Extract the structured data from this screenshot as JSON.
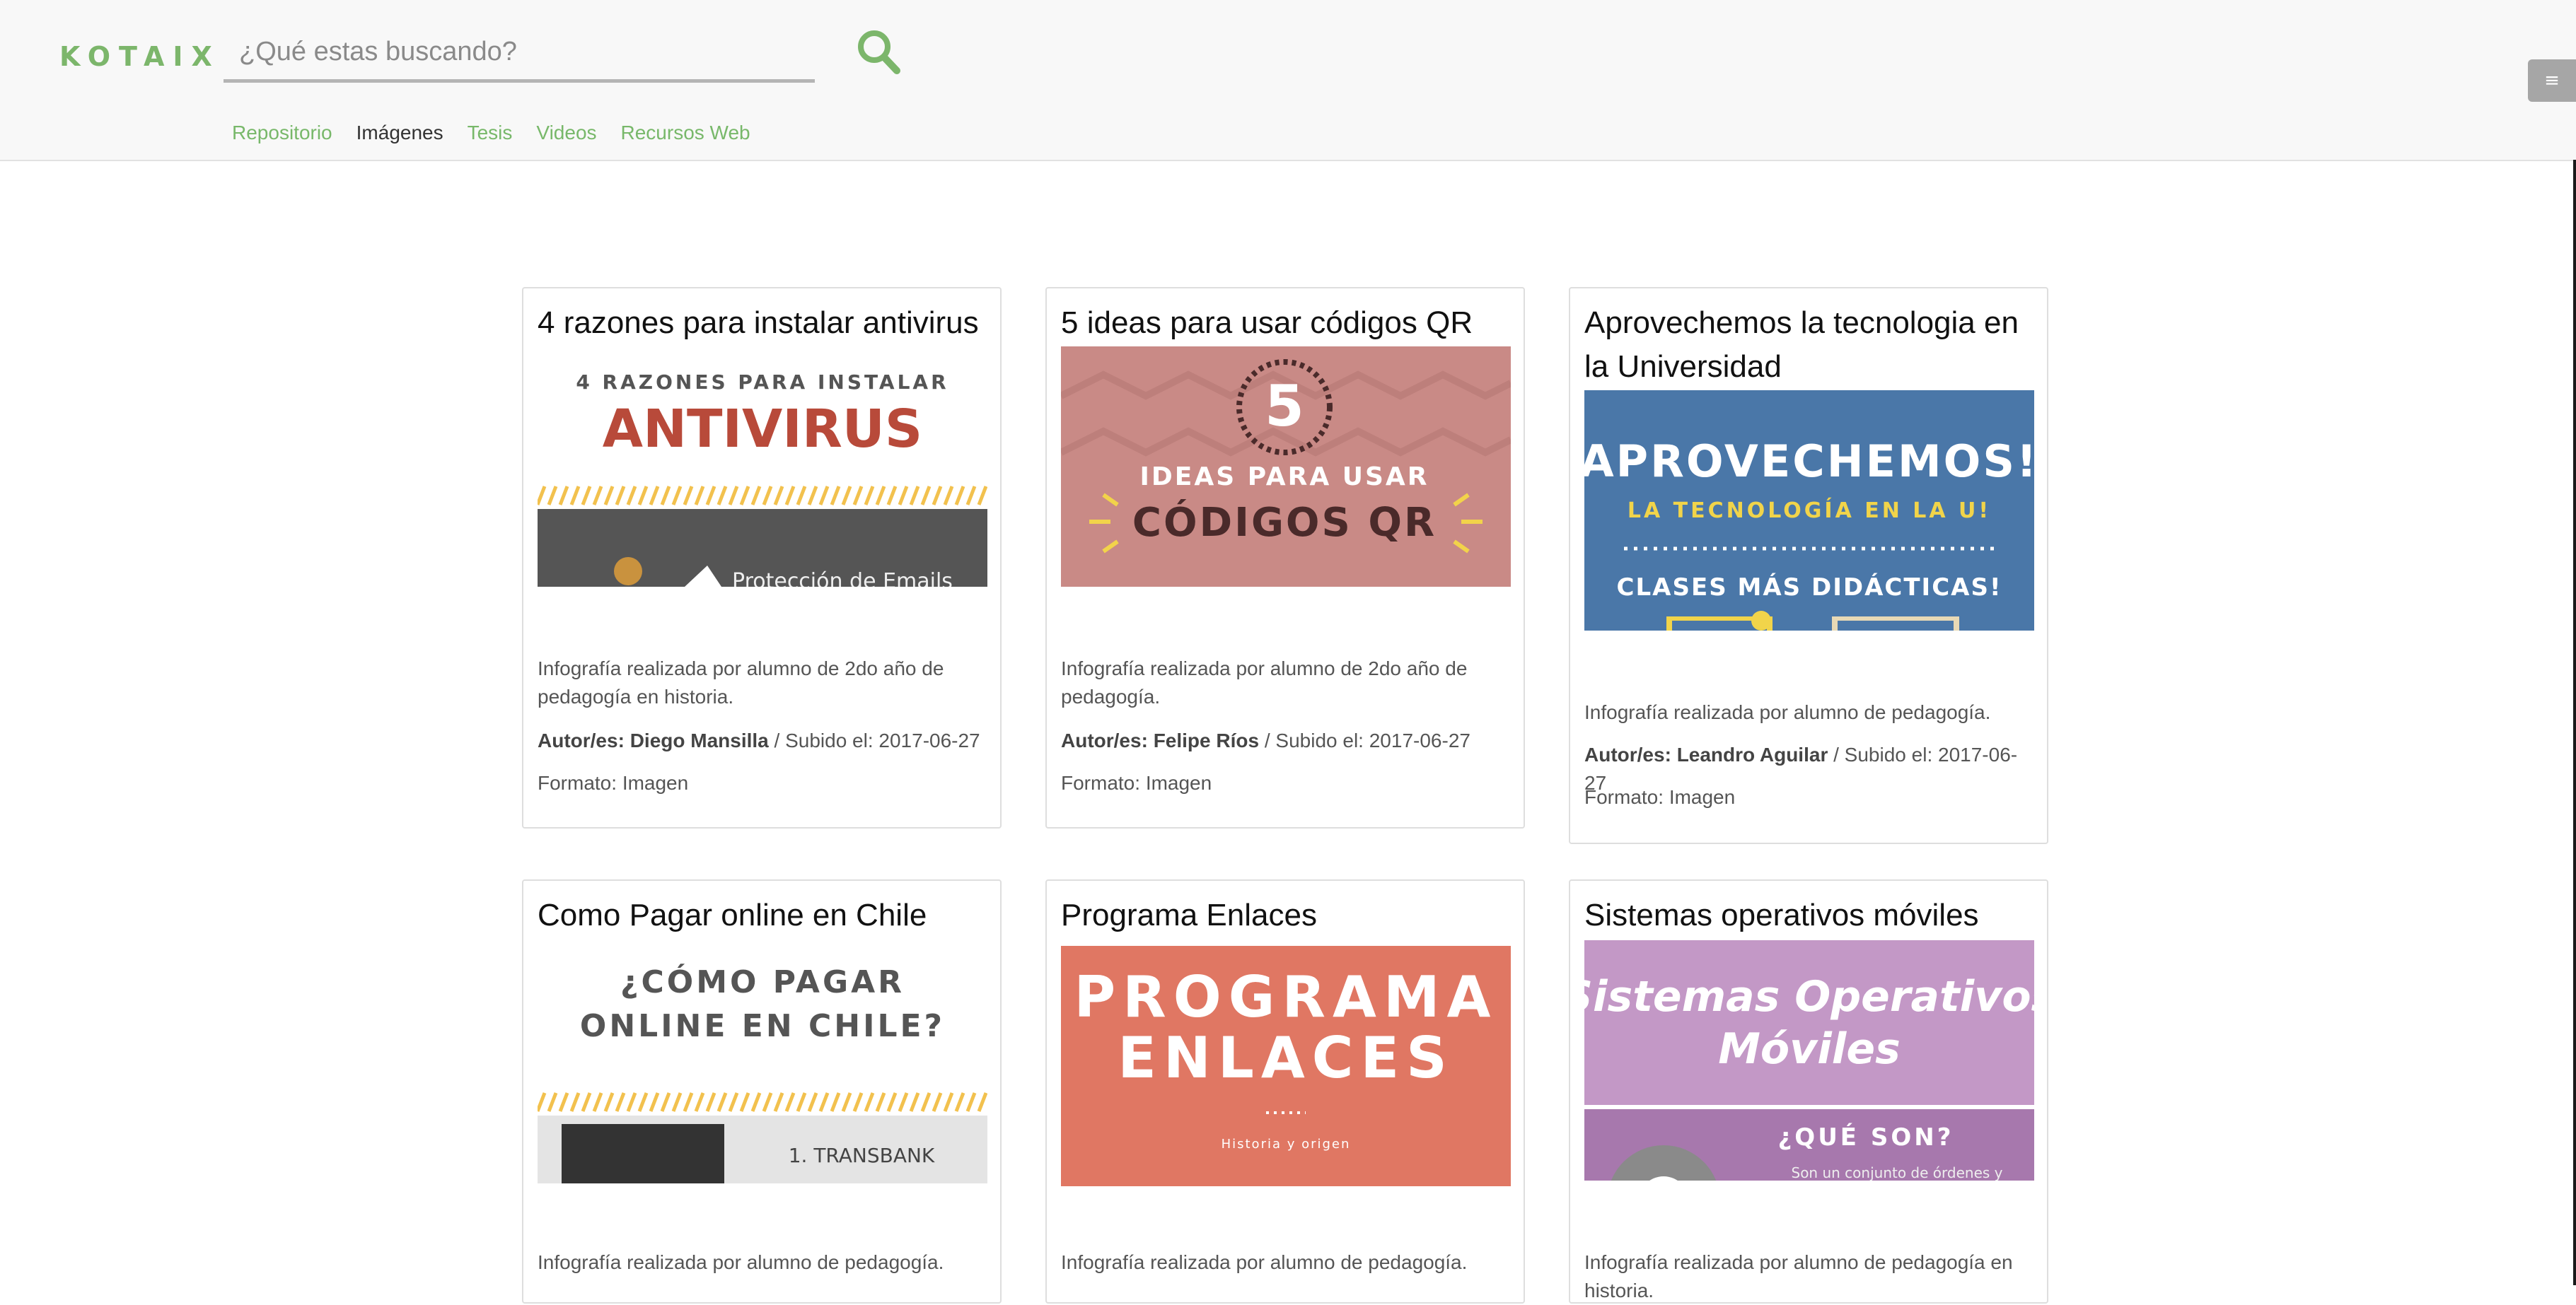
{
  "header": {
    "logo": "KOTAIX",
    "search_placeholder": "¿Qué estas buscando?",
    "menu_icon": "≡",
    "nav": [
      "Repositorio",
      "Imágenes",
      "Tesis",
      "Videos",
      "Recursos Web"
    ],
    "active_nav": "Imágenes"
  },
  "labels": {
    "author_prefix": "Autor/es:",
    "uploaded_prefix": "/ Subido el:",
    "format_prefix": "Formato:"
  },
  "cards": [
    {
      "title": "4 razones para instalar antivirus",
      "description": "Infografía realizada por alumno de 2do año de pedagogía en historia.",
      "author": "Diego Mansilla",
      "date": "2017-06-27",
      "format": "Imagen",
      "image": {
        "line1": "4 RAZONES PARA INSTALAR",
        "line2": "ANTIVIRUS",
        "line3": "Protección de Emails",
        "bg": "#ffffff",
        "accent": "#b84a3a",
        "stripe": "#f2c14e",
        "band": "#555555"
      }
    },
    {
      "title": "5 ideas para usar códigos QR",
      "description": "Infografía realizada por alumno de 2do año de pedagogía.",
      "author": "Felipe Ríos",
      "date": "2017-06-27",
      "format": "Imagen",
      "image": {
        "number": "5",
        "line1": "IDEAS PARA USAR",
        "line2": "CÓDIGOS QR",
        "bg": "#c98a86",
        "text_dark": "#4a2a2a",
        "ray": "#f2d34a"
      }
    },
    {
      "title": "Aprovechemos la tecnologia en la Universidad",
      "description": "Infografía realizada por alumno de pedagogía.",
      "author": "Leandro Aguilar",
      "date": "2017-06-27",
      "format": "Imagen",
      "image": {
        "line1": "APROVECHEMOS!",
        "line2": "LA TECNOLOGÍA EN LA U!",
        "line3": "CLASES MÁS DIDÁCTICAS!",
        "bg": "#4a77a8",
        "yellow": "#f1d44a"
      }
    },
    {
      "title": "Como Pagar online en Chile",
      "description": "Infografía realizada por alumno de pedagogía.",
      "image": {
        "line1": "¿CÓMO PAGAR",
        "line2": "ONLINE EN CHILE?",
        "line3": "1. TRANSBANK",
        "bg": "#ffffff",
        "stripe": "#f2c14e",
        "band": "#e4e4e4"
      }
    },
    {
      "title": "Programa Enlaces",
      "description": "Infografía realizada por alumno de pedagogía.",
      "image": {
        "line1": "PROGRAMA",
        "line2": "ENLACES",
        "line3": "Historia y origen",
        "bg": "#e07763"
      }
    },
    {
      "title": "Sistemas operativos móviles",
      "description": "Infografía realizada por alumno de pedagogía en historia.",
      "image": {
        "line1": "Sistemas Operativos",
        "line2": "Móviles",
        "line3": "¿QUÉ SON?",
        "line4": "Son un conjunto de órdenes y",
        "bg_top": "#c398c6",
        "bg_bottom": "#a778ad"
      }
    }
  ]
}
